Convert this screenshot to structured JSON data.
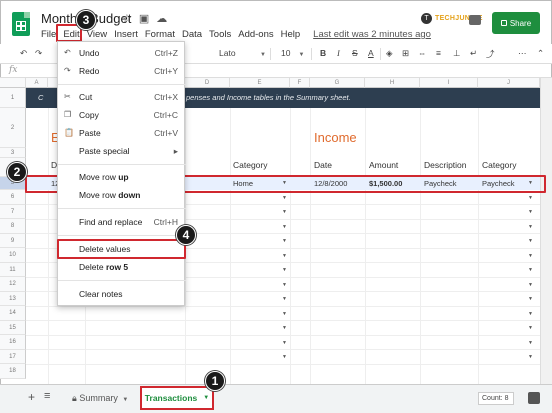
{
  "window": {
    "title": "Monthly Budget",
    "menu": [
      "File",
      "Edit",
      "View",
      "Insert",
      "Format",
      "Data",
      "Tools",
      "Add-ons",
      "Help"
    ],
    "last_edit": "Last edit was 2 minutes ago",
    "share_label": "Share",
    "watermark_text": "TECHJUNKIE"
  },
  "toolbar": {
    "zoom": "100%",
    "currency": "$",
    "percent": "%",
    "decimals_dec": ".0",
    "decimals_inc": ".00",
    "format_more": "123",
    "font": "Lato",
    "font_size": "10",
    "bold": "B",
    "italic": "I",
    "strike": "S",
    "text_color": "A"
  },
  "formula_bar": {
    "fx": "fx"
  },
  "columns": [
    "A",
    "B",
    "C",
    "D",
    "E",
    "F",
    "G",
    "H",
    "I",
    "J"
  ],
  "rows": [
    "1",
    "2",
    "3",
    "4",
    "5",
    "6",
    "7",
    "8",
    "9",
    "10",
    "11",
    "12",
    "13",
    "14",
    "15",
    "16",
    "17",
    "18",
    "19",
    "20",
    "21",
    "22"
  ],
  "sheet": {
    "banner_part1": "C",
    "banner_part2": "penses and Income tables in the Summary sheet.",
    "expenses_title": "E",
    "income_title": "Income",
    "left_headers": {
      "date": "D",
      "category": "Category"
    },
    "right_headers": {
      "date": "Date",
      "amount": "Amount",
      "description": "Description",
      "category": "Category"
    },
    "row5": {
      "date_partial": "12",
      "category": "Home",
      "income_date": "12/8/2000",
      "income_amount": "$1,500.00",
      "income_description": "Paycheck",
      "income_category": "Paycheck"
    }
  },
  "edit_menu": {
    "undo": {
      "label": "Undo",
      "shortcut": "Ctrl+Z"
    },
    "redo": {
      "label": "Redo",
      "shortcut": "Ctrl+Y"
    },
    "cut": {
      "label": "Cut",
      "shortcut": "Ctrl+X"
    },
    "copy": {
      "label": "Copy",
      "shortcut": "Ctrl+C"
    },
    "paste": {
      "label": "Paste",
      "shortcut": "Ctrl+V"
    },
    "paste_special": {
      "label": "Paste special",
      "shortcut": "▸"
    },
    "move_row_up": {
      "label_prefix": "Move row ",
      "label_bold": "up"
    },
    "move_row_down": {
      "label_prefix": "Move row ",
      "label_bold": "down"
    },
    "find_replace": {
      "label": "Find and replace",
      "shortcut": "Ctrl+H"
    },
    "delete_values": {
      "label": "Delete values"
    },
    "delete_row": {
      "label_prefix": "Delete ",
      "label_bold": "row 5"
    },
    "clear_notes": {
      "label": "Clear notes"
    }
  },
  "bottom_bar": {
    "add_sheet": "+",
    "sheet_list": "≡",
    "tabs": [
      {
        "label": "Summary"
      },
      {
        "label": "Transactions"
      }
    ],
    "count": "Count: 8"
  },
  "markers": [
    "1",
    "2",
    "3",
    "4"
  ],
  "colors": {
    "brand_green": "#1e8e3e",
    "highlight_red": "#d0282f",
    "banner_navy": "#2d3e50",
    "title_orange": "#e06b2e",
    "selection_blue": "#e8f0fe"
  }
}
